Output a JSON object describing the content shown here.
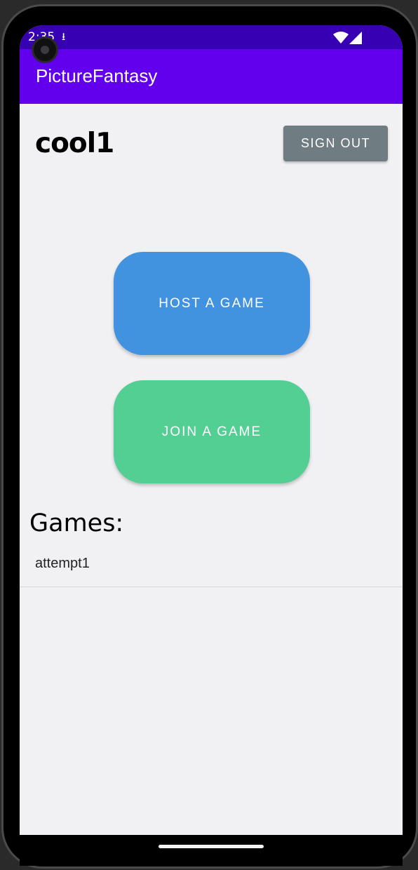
{
  "status_bar": {
    "time": "2:35",
    "notification_icon": "download-notification-icon",
    "wifi_icon": "wifi-icon",
    "signal_icon": "cell-signal-icon"
  },
  "app_bar": {
    "title": "PictureFantasy"
  },
  "header": {
    "username": "cool1",
    "sign_out_label": "SIGN OUT"
  },
  "actions": {
    "host_label": "HOST A GAME",
    "join_label": "JOIN A GAME"
  },
  "games": {
    "heading": "Games:",
    "items": [
      "attempt1"
    ]
  },
  "colors": {
    "status_bar": "#3700b3",
    "app_bar": "#6200ee",
    "sign_out": "#6f7c82",
    "host": "#4193df",
    "join": "#53cf94",
    "background": "#f1f1f3"
  }
}
